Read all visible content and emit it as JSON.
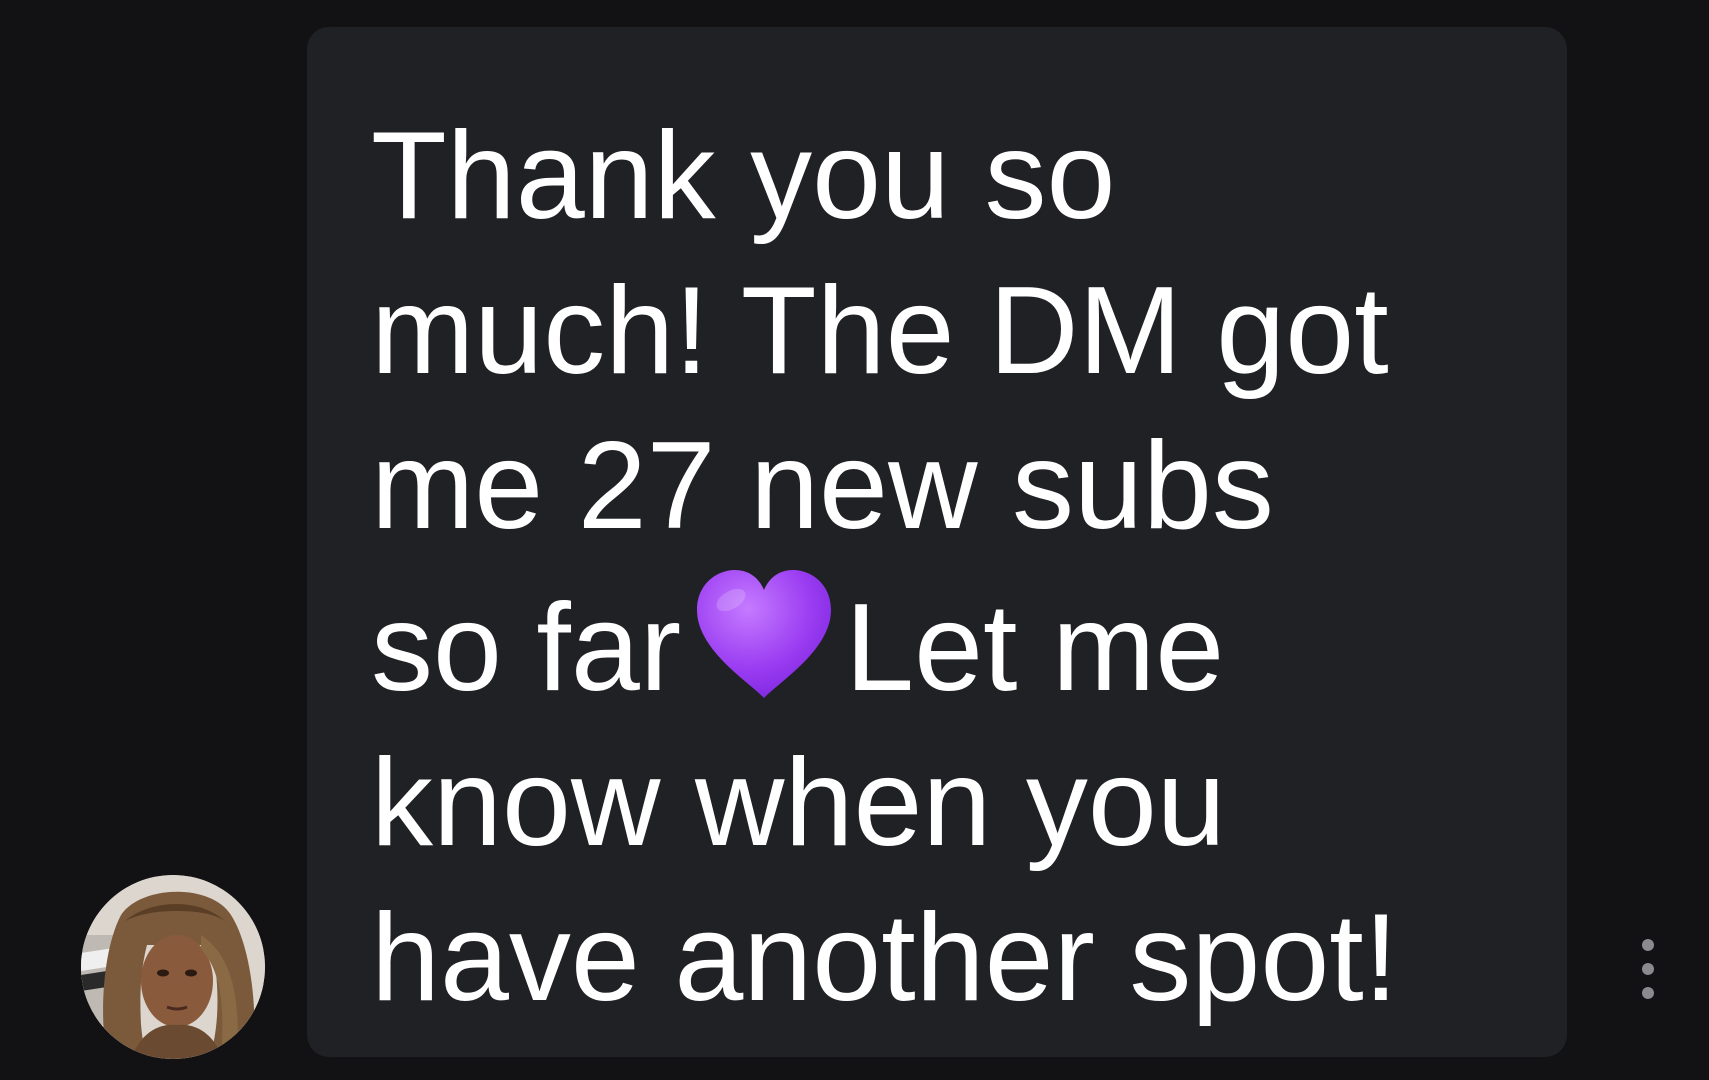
{
  "message": {
    "lines": [
      "Thank you so",
      "much! The DM got",
      "me 27 new subs",
      "so far",
      "Let me",
      "know when you",
      "have another spot!"
    ],
    "emoji": "purple-heart-icon"
  },
  "sender": {
    "avatar_icon": "user-avatar"
  },
  "actions": {
    "more_icon": "more-vertical-icon"
  },
  "colors": {
    "background": "#121214",
    "bubble": "#202125",
    "text": "#ffffff",
    "heart": "#9b3df2"
  }
}
